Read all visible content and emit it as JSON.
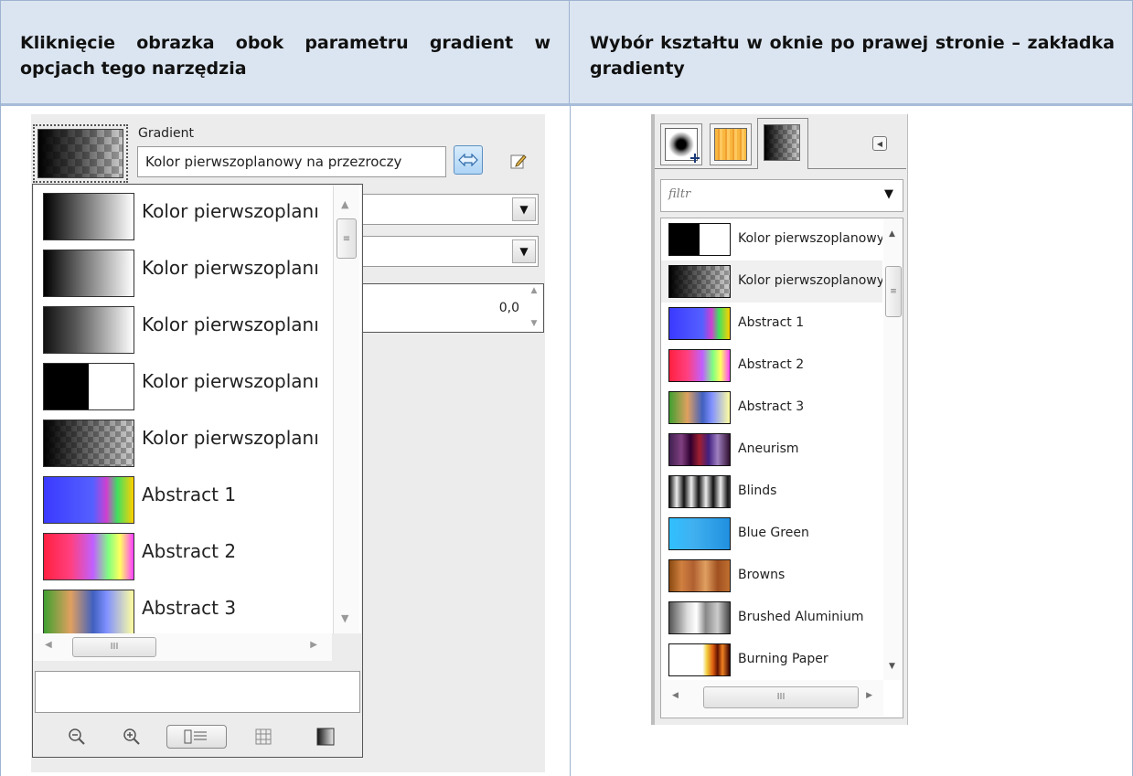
{
  "table": {
    "header_left": "Kliknięcie obrazka obok parametru gradient w opcjach tego narzędzia",
    "header_right": "Wybór kształtu w oknie po prawej stronie – zakładka gradienty"
  },
  "left_panel": {
    "gradient_label": "Gradient",
    "gradient_value": "Kolor pierwszoplanowy na przezroczy",
    "spin_value": "0,0",
    "popup_items": [
      {
        "label": "Kolor pierwszoplanı",
        "swatch": "fg-bg-rgb"
      },
      {
        "label": "Kolor pierwszoplanı",
        "swatch": "fg-bg-hardedge"
      },
      {
        "label": "Kolor pierwszoplanı",
        "swatch": "fg-bg-hsv"
      },
      {
        "label": "Kolor pierwszoplanı",
        "swatch": "fg-bg-hard"
      },
      {
        "label": "Kolor pierwszoplanı",
        "swatch": "fg-transparent"
      },
      {
        "label": "Abstract 1",
        "swatch": "abstract-1"
      },
      {
        "label": "Abstract 2",
        "swatch": "abstract-2"
      },
      {
        "label": "Abstract 3",
        "swatch": "abstract-3"
      }
    ],
    "scroll_thumb": "III"
  },
  "right_panel": {
    "filter_placeholder": "filtr",
    "items": [
      {
        "label": "Kolor pierwszoplanowy na kolor t",
        "swatch": "fg-bg-hard"
      },
      {
        "label": "Kolor pierwszoplanowy na przez",
        "swatch": "fg-transparent"
      },
      {
        "label": "Abstract 1",
        "swatch": "abstract-1"
      },
      {
        "label": "Abstract 2",
        "swatch": "abstract-2"
      },
      {
        "label": "Abstract 3",
        "swatch": "abstract-3"
      },
      {
        "label": "Aneurism",
        "swatch": "aneurism"
      },
      {
        "label": "Blinds",
        "swatch": "blinds"
      },
      {
        "label": "Blue Green",
        "swatch": "blue-green"
      },
      {
        "label": "Browns",
        "swatch": "browns"
      },
      {
        "label": "Brushed Aluminium",
        "swatch": "brushed-aluminium"
      },
      {
        "label": "Burning Paper",
        "swatch": "burning-paper"
      }
    ],
    "scroll_thumb": "III"
  }
}
